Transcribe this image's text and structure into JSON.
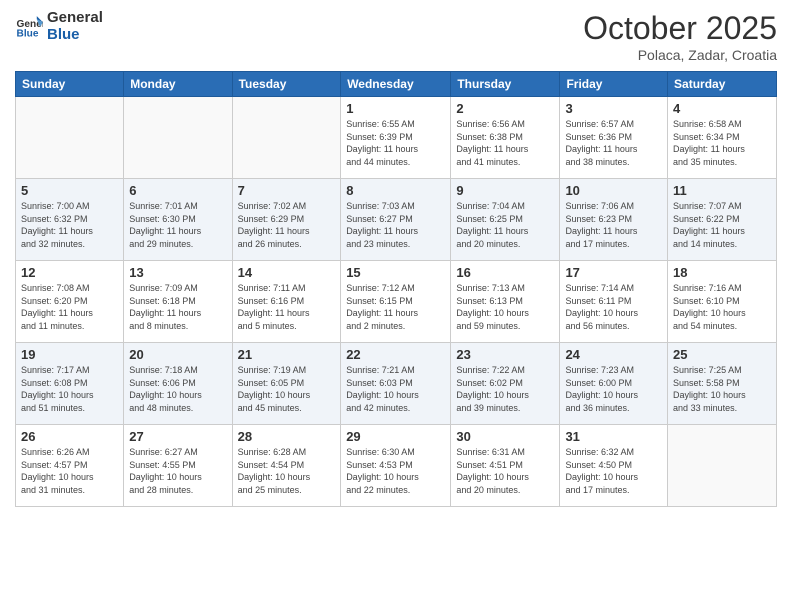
{
  "header": {
    "logo_general": "General",
    "logo_blue": "Blue",
    "month": "October 2025",
    "location": "Polaca, Zadar, Croatia"
  },
  "weekdays": [
    "Sunday",
    "Monday",
    "Tuesday",
    "Wednesday",
    "Thursday",
    "Friday",
    "Saturday"
  ],
  "weeks": [
    [
      {
        "day": "",
        "info": ""
      },
      {
        "day": "",
        "info": ""
      },
      {
        "day": "",
        "info": ""
      },
      {
        "day": "1",
        "info": "Sunrise: 6:55 AM\nSunset: 6:39 PM\nDaylight: 11 hours\nand 44 minutes."
      },
      {
        "day": "2",
        "info": "Sunrise: 6:56 AM\nSunset: 6:38 PM\nDaylight: 11 hours\nand 41 minutes."
      },
      {
        "day": "3",
        "info": "Sunrise: 6:57 AM\nSunset: 6:36 PM\nDaylight: 11 hours\nand 38 minutes."
      },
      {
        "day": "4",
        "info": "Sunrise: 6:58 AM\nSunset: 6:34 PM\nDaylight: 11 hours\nand 35 minutes."
      }
    ],
    [
      {
        "day": "5",
        "info": "Sunrise: 7:00 AM\nSunset: 6:32 PM\nDaylight: 11 hours\nand 32 minutes."
      },
      {
        "day": "6",
        "info": "Sunrise: 7:01 AM\nSunset: 6:30 PM\nDaylight: 11 hours\nand 29 minutes."
      },
      {
        "day": "7",
        "info": "Sunrise: 7:02 AM\nSunset: 6:29 PM\nDaylight: 11 hours\nand 26 minutes."
      },
      {
        "day": "8",
        "info": "Sunrise: 7:03 AM\nSunset: 6:27 PM\nDaylight: 11 hours\nand 23 minutes."
      },
      {
        "day": "9",
        "info": "Sunrise: 7:04 AM\nSunset: 6:25 PM\nDaylight: 11 hours\nand 20 minutes."
      },
      {
        "day": "10",
        "info": "Sunrise: 7:06 AM\nSunset: 6:23 PM\nDaylight: 11 hours\nand 17 minutes."
      },
      {
        "day": "11",
        "info": "Sunrise: 7:07 AM\nSunset: 6:22 PM\nDaylight: 11 hours\nand 14 minutes."
      }
    ],
    [
      {
        "day": "12",
        "info": "Sunrise: 7:08 AM\nSunset: 6:20 PM\nDaylight: 11 hours\nand 11 minutes."
      },
      {
        "day": "13",
        "info": "Sunrise: 7:09 AM\nSunset: 6:18 PM\nDaylight: 11 hours\nand 8 minutes."
      },
      {
        "day": "14",
        "info": "Sunrise: 7:11 AM\nSunset: 6:16 PM\nDaylight: 11 hours\nand 5 minutes."
      },
      {
        "day": "15",
        "info": "Sunrise: 7:12 AM\nSunset: 6:15 PM\nDaylight: 11 hours\nand 2 minutes."
      },
      {
        "day": "16",
        "info": "Sunrise: 7:13 AM\nSunset: 6:13 PM\nDaylight: 10 hours\nand 59 minutes."
      },
      {
        "day": "17",
        "info": "Sunrise: 7:14 AM\nSunset: 6:11 PM\nDaylight: 10 hours\nand 56 minutes."
      },
      {
        "day": "18",
        "info": "Sunrise: 7:16 AM\nSunset: 6:10 PM\nDaylight: 10 hours\nand 54 minutes."
      }
    ],
    [
      {
        "day": "19",
        "info": "Sunrise: 7:17 AM\nSunset: 6:08 PM\nDaylight: 10 hours\nand 51 minutes."
      },
      {
        "day": "20",
        "info": "Sunrise: 7:18 AM\nSunset: 6:06 PM\nDaylight: 10 hours\nand 48 minutes."
      },
      {
        "day": "21",
        "info": "Sunrise: 7:19 AM\nSunset: 6:05 PM\nDaylight: 10 hours\nand 45 minutes."
      },
      {
        "day": "22",
        "info": "Sunrise: 7:21 AM\nSunset: 6:03 PM\nDaylight: 10 hours\nand 42 minutes."
      },
      {
        "day": "23",
        "info": "Sunrise: 7:22 AM\nSunset: 6:02 PM\nDaylight: 10 hours\nand 39 minutes."
      },
      {
        "day": "24",
        "info": "Sunrise: 7:23 AM\nSunset: 6:00 PM\nDaylight: 10 hours\nand 36 minutes."
      },
      {
        "day": "25",
        "info": "Sunrise: 7:25 AM\nSunset: 5:58 PM\nDaylight: 10 hours\nand 33 minutes."
      }
    ],
    [
      {
        "day": "26",
        "info": "Sunrise: 6:26 AM\nSunset: 4:57 PM\nDaylight: 10 hours\nand 31 minutes."
      },
      {
        "day": "27",
        "info": "Sunrise: 6:27 AM\nSunset: 4:55 PM\nDaylight: 10 hours\nand 28 minutes."
      },
      {
        "day": "28",
        "info": "Sunrise: 6:28 AM\nSunset: 4:54 PM\nDaylight: 10 hours\nand 25 minutes."
      },
      {
        "day": "29",
        "info": "Sunrise: 6:30 AM\nSunset: 4:53 PM\nDaylight: 10 hours\nand 22 minutes."
      },
      {
        "day": "30",
        "info": "Sunrise: 6:31 AM\nSunset: 4:51 PM\nDaylight: 10 hours\nand 20 minutes."
      },
      {
        "day": "31",
        "info": "Sunrise: 6:32 AM\nSunset: 4:50 PM\nDaylight: 10 hours\nand 17 minutes."
      },
      {
        "day": "",
        "info": ""
      }
    ]
  ]
}
